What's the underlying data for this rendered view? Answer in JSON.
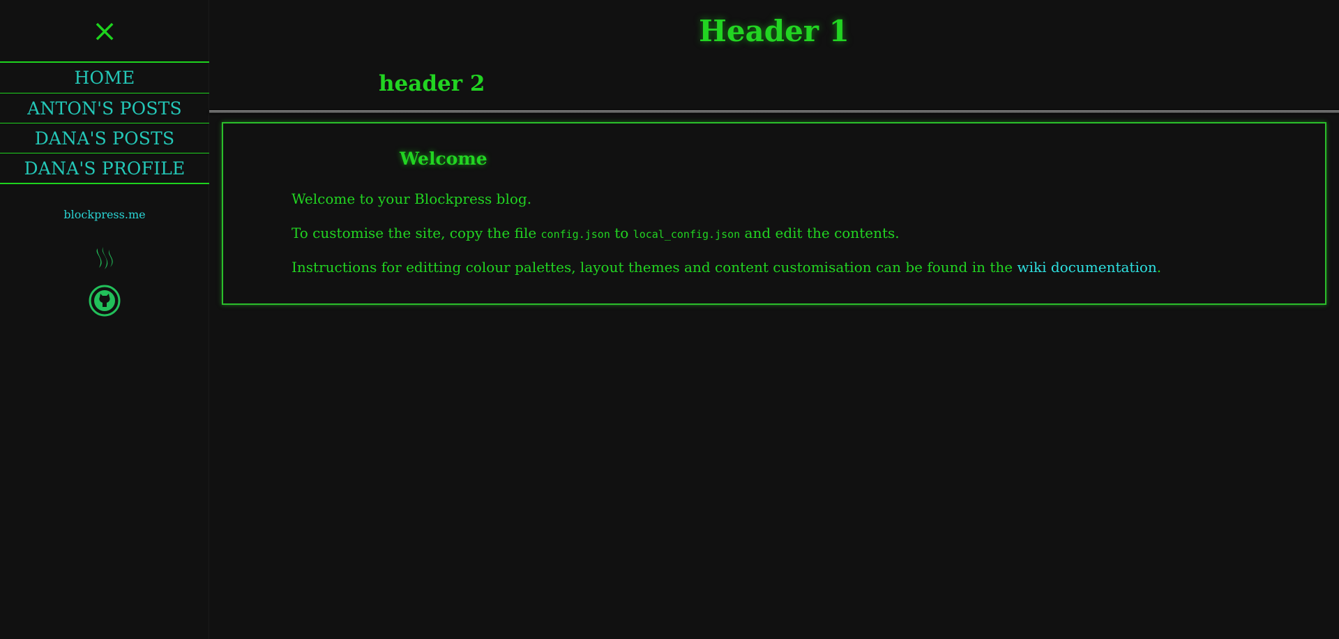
{
  "sidebar": {
    "close_icon": "×",
    "items": [
      {
        "label": "HOME"
      },
      {
        "label": "ANTON'S POSTS"
      },
      {
        "label": "DANA'S POSTS"
      },
      {
        "label": "DANA'S PROFILE"
      }
    ],
    "site_link": "blockpress.me",
    "social_icons": [
      "steem-icon",
      "github-icon"
    ]
  },
  "main": {
    "header1": "Header 1",
    "header2": "header 2",
    "card": {
      "title": "Welcome",
      "p1": "Welcome to your Blockpress blog.",
      "p2_before": "To customise the site, copy the file ",
      "p2_code1": "config.json",
      "p2_mid": " to ",
      "p2_code2": "local_config.json",
      "p2_after": " and edit the contents.",
      "p3_before": "Instructions for editting colour palettes, layout themes and content customisation can be found in the ",
      "p3_link": "wiki documentation",
      "p3_after": "."
    }
  },
  "colors": {
    "background": "#111111",
    "accent_green": "#22d422",
    "nav_text": "#24c8b8",
    "link": "#2ee0e0"
  }
}
